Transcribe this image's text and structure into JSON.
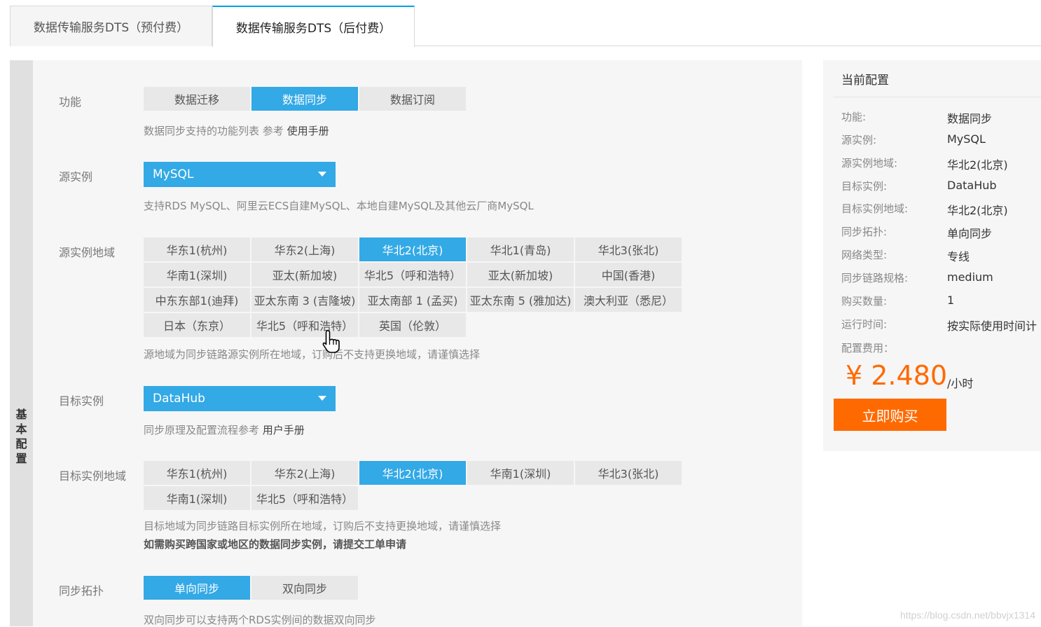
{
  "tabs": [
    "数据传输服务DTS（预付费）",
    "数据传输服务DTS（后付费）"
  ],
  "side_label": [
    "基",
    "本",
    "配",
    "置"
  ],
  "function": {
    "label": "功能",
    "options": [
      "数据迁移",
      "数据同步",
      "数据订阅"
    ],
    "selected": "数据同步",
    "hint": "数据同步支持的功能列表 参考",
    "hint_link": "使用手册"
  },
  "source_instance": {
    "label": "源实例",
    "value": "MySQL",
    "hint": "支持RDS MySQL、阿里云ECS自建MySQL、本地自建MySQL及其他云厂商MySQL"
  },
  "source_region": {
    "label": "源实例地域",
    "options": [
      "华东1(杭州)",
      "华东2(上海)",
      "华北2(北京)",
      "华北1(青岛)",
      "华北3(张北)",
      "华南1(深圳)",
      "亚太(新加坡)",
      "华北5（呼和浩特）",
      "亚太(新加坡)",
      "中国(香港)",
      "中东东部1(迪拜)",
      "亚太东南 3 (吉隆坡)",
      "亚太南部 1 (孟买)",
      "亚太东南 5 (雅加达)",
      "澳大利亚（悉尼）",
      "日本（东京）",
      "华北5（呼和浩特）",
      "英国（伦敦）"
    ],
    "selected_index": 2,
    "hint": "源地域为同步链路源实例所在地域，订购后不支持更换地域，请谨慎选择"
  },
  "target_instance": {
    "label": "目标实例",
    "value": "DataHub",
    "hint": "同步原理及配置流程参考",
    "hint_link": "用户手册"
  },
  "target_region": {
    "label": "目标实例地域",
    "options": [
      "华东1(杭州)",
      "华东2(上海)",
      "华北2(北京)",
      "华南1(深圳)",
      "华北3(张北)",
      "华南1(深圳)",
      "华北5（呼和浩特）"
    ],
    "selected_index": 2,
    "hint1": "目标地域为同步链路目标实例所在地域，订购后不支持更换地域，请谨慎选择",
    "hint2": "如需购买跨国家或地区的数据同步实例，请提交工单申请"
  },
  "topology": {
    "label": "同步拓扑",
    "options": [
      "单向同步",
      "双向同步"
    ],
    "selected": "单向同步",
    "hint": "双向同步可以支持两个RDS实例间的数据双向同步"
  },
  "summary": {
    "title": "当前配置",
    "rows": [
      {
        "key": "功能:",
        "value": "数据同步"
      },
      {
        "key": "源实例:",
        "value": "MySQL"
      },
      {
        "key": "源实例地域:",
        "value": "华北2(北京)"
      },
      {
        "key": "目标实例:",
        "value": "DataHub"
      },
      {
        "key": "目标实例地域:",
        "value": "华北2(北京)"
      },
      {
        "key": "同步拓扑:",
        "value": "单向同步"
      },
      {
        "key": "网络类型:",
        "value": "专线"
      },
      {
        "key": "同步链路规格:",
        "value": "medium"
      },
      {
        "key": "购买数量:",
        "value": "1"
      },
      {
        "key": "运行时间:",
        "value": "按实际使用时间计"
      }
    ],
    "fee_label": "配置费用：",
    "price": "¥ 2.480",
    "unit": "/小时",
    "buy_label": "立即购买"
  },
  "watermark": "https://blog.csdn.net/bbvjx1314",
  "colors": {
    "accent": "#33a9e6",
    "buy": "#ff6a00",
    "tab_active_border": "#00a2e1"
  }
}
